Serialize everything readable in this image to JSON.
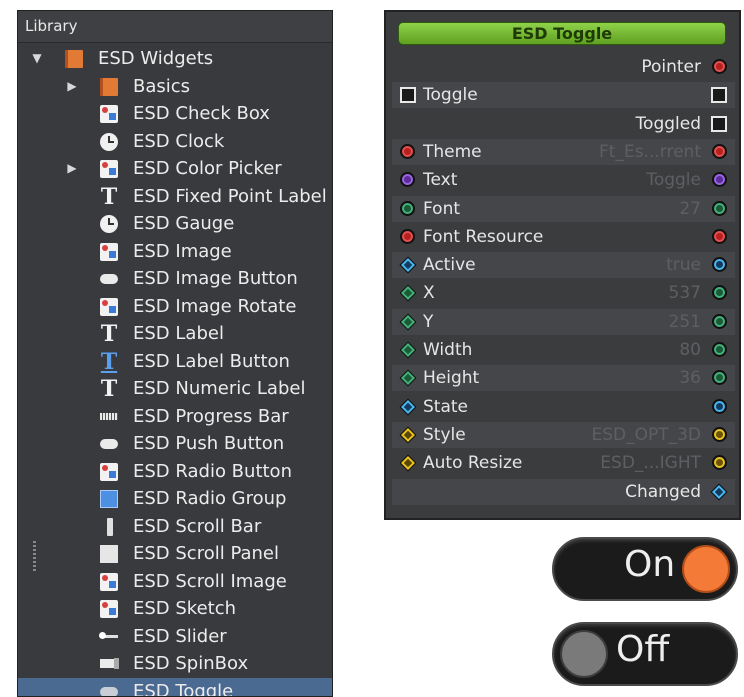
{
  "library": {
    "title": "Library",
    "items": [
      {
        "label": "ESD Widgets",
        "icon": "book-icon",
        "level": 0,
        "arrow": "expanded"
      },
      {
        "label": "Basics",
        "icon": "book-icon",
        "level": 1,
        "arrow": "collapsed"
      },
      {
        "label": "ESD Check Box",
        "icon": "image-icon",
        "level": 1
      },
      {
        "label": "ESD Clock",
        "icon": "clock-icon",
        "level": 1
      },
      {
        "label": "ESD Color Picker",
        "icon": "image-icon",
        "level": 1,
        "arrow": "collapsed"
      },
      {
        "label": "ESD Fixed Point Label",
        "icon": "text-icon",
        "level": 1
      },
      {
        "label": "ESD Gauge",
        "icon": "clock-icon",
        "level": 1
      },
      {
        "label": "ESD Image",
        "icon": "image-icon",
        "level": 1
      },
      {
        "label": "ESD Image Button",
        "icon": "button-icon",
        "level": 1
      },
      {
        "label": "ESD Image Rotate",
        "icon": "image-icon",
        "level": 1
      },
      {
        "label": "ESD Label",
        "icon": "text-icon",
        "level": 1
      },
      {
        "label": "ESD Label Button",
        "icon": "text-button-icon",
        "level": 1
      },
      {
        "label": "ESD Numeric Label",
        "icon": "text-icon",
        "level": 1
      },
      {
        "label": "ESD Progress Bar",
        "icon": "progress-icon",
        "level": 1
      },
      {
        "label": "ESD Push Button",
        "icon": "button-icon",
        "level": 1
      },
      {
        "label": "ESD Radio Button",
        "icon": "image-icon",
        "level": 1
      },
      {
        "label": "ESD Radio Group",
        "icon": "group-icon",
        "level": 1
      },
      {
        "label": "ESD Scroll Bar",
        "icon": "scrollbar-icon",
        "level": 1
      },
      {
        "label": "ESD Scroll Panel",
        "icon": "panel-icon",
        "level": 1
      },
      {
        "label": "ESD Scroll Image",
        "icon": "image-icon",
        "level": 1
      },
      {
        "label": "ESD Sketch",
        "icon": "image-icon",
        "level": 1
      },
      {
        "label": "ESD Slider",
        "icon": "slider-icon",
        "level": 1
      },
      {
        "label": "ESD SpinBox",
        "icon": "spinbox-icon",
        "level": 1
      },
      {
        "label": "ESD Toggle",
        "icon": "toggle-icon",
        "level": 1,
        "selected": true
      }
    ]
  },
  "node": {
    "title": "ESD Toggle",
    "title_color": "#6cb82c",
    "rows": [
      {
        "label": "Pointer",
        "align": "right",
        "right_pin": "red-circle"
      },
      {
        "label": "Toggle",
        "left_pin": "square",
        "right_pin": "square"
      },
      {
        "label": "Toggled",
        "align": "right",
        "right_pin": "square"
      },
      {
        "label": "Theme",
        "value": "Ft_Es...rrent",
        "left_pin": "red-circle",
        "right_pin": "red-circle"
      },
      {
        "label": "Text",
        "value": "Toggle",
        "left_pin": "purple-circle",
        "right_pin": "purple-circle"
      },
      {
        "label": "Font",
        "value": "27",
        "left_pin": "green-circle",
        "right_pin": "green-circle"
      },
      {
        "label": "Font Resource",
        "value": "",
        "left_pin": "red-circle",
        "right_pin": "red-circle"
      },
      {
        "label": "Active",
        "value": "true",
        "left_pin": "blue-diamond",
        "right_pin": "blue-circle"
      },
      {
        "label": "X",
        "value": "537",
        "left_pin": "green-diamond",
        "right_pin": "green-circle"
      },
      {
        "label": "Y",
        "value": "251",
        "left_pin": "green-diamond",
        "right_pin": "green-circle"
      },
      {
        "label": "Width",
        "value": "80",
        "left_pin": "green-diamond",
        "right_pin": "green-circle"
      },
      {
        "label": "Height",
        "value": "36",
        "left_pin": "green-diamond",
        "right_pin": "green-circle"
      },
      {
        "label": "State",
        "value": "",
        "left_pin": "blue-diamond",
        "right_pin": "blue-circle"
      },
      {
        "label": "Style",
        "value": "ESD_OPT_3D",
        "left_pin": "yellow-diamond",
        "right_pin": "yellow-circle"
      },
      {
        "label": "Auto Resize",
        "value": "ESD_...IGHT",
        "left_pin": "yellow-diamond",
        "right_pin": "yellow-circle"
      },
      {
        "label": "Changed",
        "align": "right",
        "right_pin": "blue-diamond"
      }
    ]
  },
  "previews": {
    "on": {
      "label": "On",
      "knob_color": "#f47a38"
    },
    "off": {
      "label": "Off",
      "knob_color": "#7a7a7a"
    }
  }
}
